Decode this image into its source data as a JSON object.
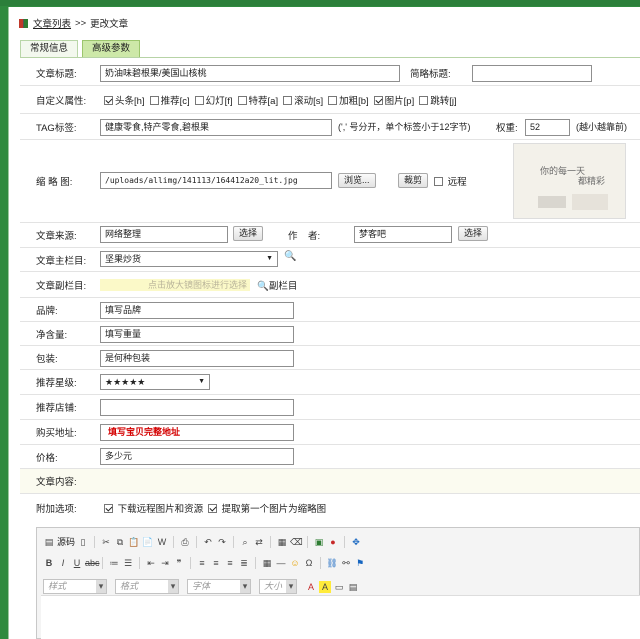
{
  "breadcrumb": {
    "list_link": "文章列表",
    "sep": ">>",
    "current": "更改文章"
  },
  "tabs": [
    {
      "label": "常规信息"
    },
    {
      "label": "高级参数"
    }
  ],
  "fields": {
    "title": {
      "label": "文章标题:",
      "value": "奶油味碧根果/美国山核桃"
    },
    "short_title": {
      "label": "简略标题:",
      "value": ""
    },
    "flags": {
      "label": "自定义属性:",
      "items": [
        {
          "label": "头条[h]",
          "checked": true
        },
        {
          "label": "推荐[c]",
          "checked": false
        },
        {
          "label": "幻灯[f]",
          "checked": false
        },
        {
          "label": "特荐[a]",
          "checked": false
        },
        {
          "label": "滚动[s]",
          "checked": false
        },
        {
          "label": "加粗[b]",
          "checked": false
        },
        {
          "label": "图片[p]",
          "checked": true
        },
        {
          "label": "跳转[j]",
          "checked": false
        }
      ]
    },
    "tags": {
      "label": "TAG标签:",
      "value": "健康零食,特产零食,碧根果",
      "note": "(',' 号分开，单个标签小于12字节)"
    },
    "weight": {
      "label": "权重:",
      "value": "52",
      "note": "(越小越靠前)"
    },
    "thumb": {
      "label": "缩 略 图:",
      "value": "/uploads/allimg/141113/164412a20_lit.jpg",
      "browse": "浏览...",
      "crop": "裁剪",
      "remote": "远程",
      "preview_text1": "你的每一天",
      "preview_text2": "都精彩"
    },
    "source": {
      "label": "文章来源:",
      "value": "网络整理",
      "select": "选择"
    },
    "author": {
      "label": "作    者:",
      "value": "梦客吧",
      "select": "选择"
    },
    "main_column": {
      "label": "文章主栏目:",
      "value": "坚果炒货"
    },
    "sub_column": {
      "label": "文章副栏目:",
      "hint": "点击放大镜图标进行选择",
      "link": "副栏目"
    },
    "brand": {
      "label": "品牌:",
      "value": "填写品牌"
    },
    "net_weight": {
      "label": "净含量:",
      "value": "填写重量"
    },
    "package": {
      "label": "包装:",
      "value": "是何种包装"
    },
    "stars": {
      "label": "推荐星级:",
      "value": "★★★★★"
    },
    "shop": {
      "label": "推荐店铺:",
      "value": ""
    },
    "buy_url": {
      "label": "购买地址:",
      "value": "填写宝贝完整地址"
    },
    "price": {
      "label": "价格:",
      "value": "多少元"
    },
    "content": {
      "label": "文章内容:"
    },
    "extra": {
      "label": "附加选项:",
      "download": "下载远程图片和资源",
      "first_pic": "提取第一个图片为缩略图"
    }
  },
  "editor": {
    "source_label": "源码",
    "style_placeholder": "样式",
    "format_placeholder": "格式",
    "font_placeholder": "字体",
    "size_placeholder": "大小"
  },
  "colors": {
    "accent_green": "#2f8a3e",
    "tab_active": "#cde8a8",
    "required_red": "#d40000"
  }
}
